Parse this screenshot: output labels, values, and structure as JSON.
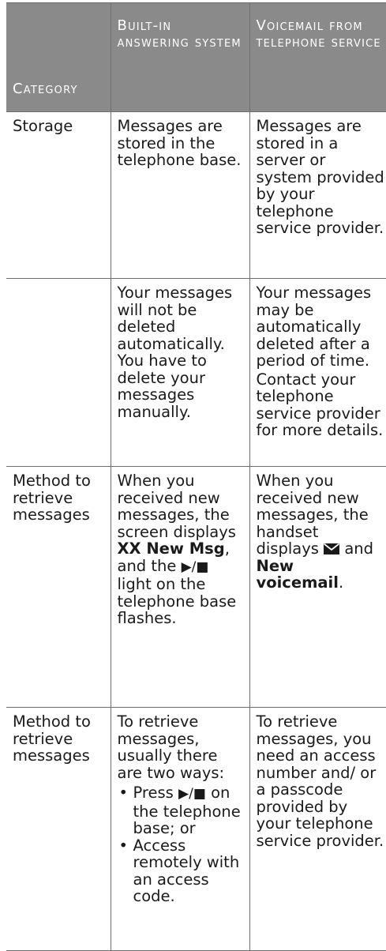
{
  "headers": {
    "col1": "Category",
    "col2": "Built-in answering system",
    "col3": "Voicemail from telephone service"
  },
  "rows": [
    {
      "category": "Storage",
      "builtin": "Messages are stored in the telephone base.",
      "voicemail": "Messages are stored in a server or system provided by your telephone service provider."
    },
    {
      "category": "",
      "builtin": "Your messages will not be deleted automatically. You have to delete your messages manually.",
      "voicemail_a": "Your messages may be automatically deleted after a period of time.",
      "voicemail_b": "Contact your telephone service provider for more details."
    },
    {
      "category": "Method to retrieve messages",
      "builtin_pre": "When you received new messages, the screen displays",
      "builtin_bold": "XX New Msg",
      "builtin_mid": ", and the",
      "builtin_post": "light on the telephone base flashes.",
      "voicemail_pre": "When you received new messages, the handset displays",
      "voicemail_and": "and",
      "voicemail_bold": "New voicemail",
      "voicemail_end": "."
    },
    {
      "category": "Method to retrieve messages",
      "builtin_intro": "To retrieve messages, usually there are two ways:",
      "bullet1_pre": "Press",
      "bullet1_post": "on the telephone base; or",
      "bullet2": "Access remotely with an access code.",
      "voicemail": "To retrieve messages, you need an access number and/ or a passcode provided by your telephone service provider."
    }
  ],
  "icons": {
    "play_stop": "play-stop-icon",
    "envelope": "envelope-icon",
    "bullet": "•"
  }
}
